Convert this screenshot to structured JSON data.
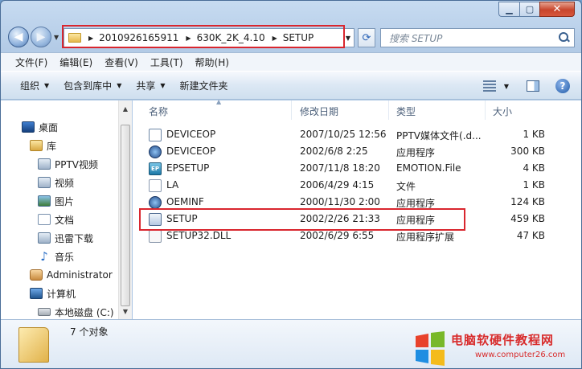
{
  "nav": {
    "path": [
      "2010926165911",
      "630K_2K_4.10",
      "SETUP"
    ],
    "search_placeholder": "搜索 SETUP"
  },
  "menubar": [
    "文件(F)",
    "编辑(E)",
    "查看(V)",
    "工具(T)",
    "帮助(H)"
  ],
  "toolbar": {
    "organize": "组织",
    "include_library": "包含到库中",
    "share": "共享",
    "new_folder": "新建文件夹"
  },
  "sidebar": {
    "items": [
      {
        "label": "桌面",
        "icon": "desktop-icon"
      },
      {
        "label": "库",
        "icon": "library-icon"
      },
      {
        "label": "PPTV视频",
        "icon": "pptv-folder-icon"
      },
      {
        "label": "视频",
        "icon": "video-library-icon"
      },
      {
        "label": "图片",
        "icon": "pictures-library-icon"
      },
      {
        "label": "文档",
        "icon": "documents-library-icon"
      },
      {
        "label": "迅雷下载",
        "icon": "download-folder-icon"
      },
      {
        "label": "音乐",
        "icon": "music-library-icon"
      },
      {
        "label": "Administrator",
        "icon": "user-folder-icon"
      },
      {
        "label": "计算机",
        "icon": "computer-icon"
      },
      {
        "label": "本地磁盘 (C:)",
        "icon": "drive-icon"
      }
    ]
  },
  "columns": {
    "name": "名称",
    "modified": "修改日期",
    "type": "类型",
    "size": "大小"
  },
  "files": [
    {
      "name": "DEVICEOP",
      "modified": "2007/10/25 12:56",
      "type": "PPTV媒体文件(.d...",
      "size": "1 KB",
      "icon": "config-file-icon"
    },
    {
      "name": "DEVICEOP",
      "modified": "2002/6/8 2:25",
      "type": "应用程序",
      "size": "300 KB",
      "icon": "cd-exe-icon"
    },
    {
      "name": "EPSETUP",
      "modified": "2007/11/8 18:20",
      "type": "EMOTION.File",
      "size": "4 KB",
      "icon": "emotion-file-icon"
    },
    {
      "name": "LA",
      "modified": "2006/4/29 4:15",
      "type": "文件",
      "size": "1 KB",
      "icon": "blank-file-icon"
    },
    {
      "name": "OEMINF",
      "modified": "2000/11/30 2:00",
      "type": "应用程序",
      "size": "124 KB",
      "icon": "cd-exe-icon"
    },
    {
      "name": "SETUP",
      "modified": "2002/2/26 21:33",
      "type": "应用程序",
      "size": "459 KB",
      "icon": "setup-exe-icon"
    },
    {
      "name": "SETUP32.DLL",
      "modified": "2002/6/29 6:55",
      "type": "应用程序扩展",
      "size": "47 KB",
      "icon": "dll-file-icon"
    }
  ],
  "status": {
    "count": "7 个对象"
  },
  "watermark": {
    "title": "电脑软硬件教程网",
    "url": "www.computer26.com"
  },
  "colors": {
    "highlight": "#d9262e",
    "watermark": "#d82b2b"
  }
}
